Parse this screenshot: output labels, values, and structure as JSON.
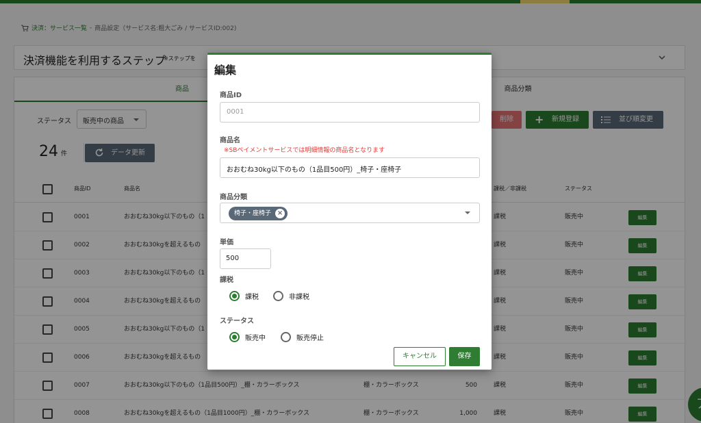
{
  "breadcrumb": {
    "root": "決済：サービス一覧",
    "separator": " - ",
    "current": "商品設定（サービス名:粗大ごみ / サービスID:002)"
  },
  "step_panel": {
    "title": "決済機能を利用するステップ",
    "note": "※ステップを"
  },
  "tabs": [
    {
      "label": "商品"
    },
    {
      "label": "商品分類"
    }
  ],
  "toolbar": {
    "status_label": "ステータス",
    "status_value": "販売中の商品",
    "delete_label": "削除",
    "new_label": "新規登録",
    "sort_label": "並び順変更",
    "count": "24",
    "count_unit": "件",
    "refresh_label": "データ更新"
  },
  "table": {
    "headers": {
      "id": "商品ID",
      "name": "商品名",
      "tax": "課税／非課税",
      "status": "ステータス"
    },
    "rows": [
      {
        "id": "0001",
        "name": "おおむね30kg以下のもの（1",
        "category": "",
        "price": "",
        "tax": "課税",
        "status": "販売中",
        "edit": "編集"
      },
      {
        "id": "0002",
        "name": "おおむね30kgを超えるもの",
        "category": "",
        "price": "",
        "tax": "課税",
        "status": "販売中",
        "edit": "編集"
      },
      {
        "id": "0003",
        "name": "おおむね30kg以下のもの（1",
        "category": "",
        "price": "",
        "tax": "課税",
        "status": "販売中",
        "edit": "編集"
      },
      {
        "id": "0004",
        "name": "おおむね30kgを超えるもの",
        "category": "",
        "price": "",
        "tax": "課税",
        "status": "販売中",
        "edit": "編集"
      },
      {
        "id": "0005",
        "name": "おおむね30kg以下のもの（1",
        "category": "",
        "price": "",
        "tax": "課税",
        "status": "販売中",
        "edit": "編集"
      },
      {
        "id": "0006",
        "name": "おおむね30kgを超えるもの",
        "category": "",
        "price": "",
        "tax": "課税",
        "status": "販売中",
        "edit": "編集"
      },
      {
        "id": "0007",
        "name": "おおむね30kg以下のもの（1品目500円）_棚・カラーボックス",
        "category": "棚・カラーボックス",
        "price": "500",
        "tax": "課税",
        "status": "販売中",
        "edit": "編集"
      },
      {
        "id": "0008",
        "name": "おおむね30kgを超えるもの（1品目1000円）_棚・カラーボックス",
        "category": "棚・カラーボックス",
        "price": "1,000",
        "tax": "課税",
        "status": "販売中",
        "edit": "編集"
      }
    ]
  },
  "fab": {
    "label": "ア"
  },
  "modal": {
    "title": "編集",
    "product_id_label": "商品ID",
    "product_id_placeholder": "0001",
    "product_name_label": "商品名",
    "product_name_note": "※SBペイメントサービスでは明細情報の商品名となります",
    "product_name_value": "おおむね30kg以下のもの（1品目500円）_椅子・座椅子",
    "category_label": "商品分類",
    "category_chip": "椅子・座椅子",
    "price_label": "単価",
    "price_value": "500",
    "tax_label": "課税",
    "tax_options": [
      {
        "label": "課税",
        "selected": true
      },
      {
        "label": "非課税",
        "selected": false
      }
    ],
    "status_label": "ステータス",
    "status_options": [
      {
        "label": "販売中",
        "selected": true
      },
      {
        "label": "販売停止",
        "selected": false
      }
    ],
    "cancel_label": "キャンセル",
    "save_label": "保存"
  },
  "colors": {
    "primary": "#2e7d32",
    "danger": "#e57373",
    "secondary": "#5a6978",
    "note_red": "#e53935"
  }
}
